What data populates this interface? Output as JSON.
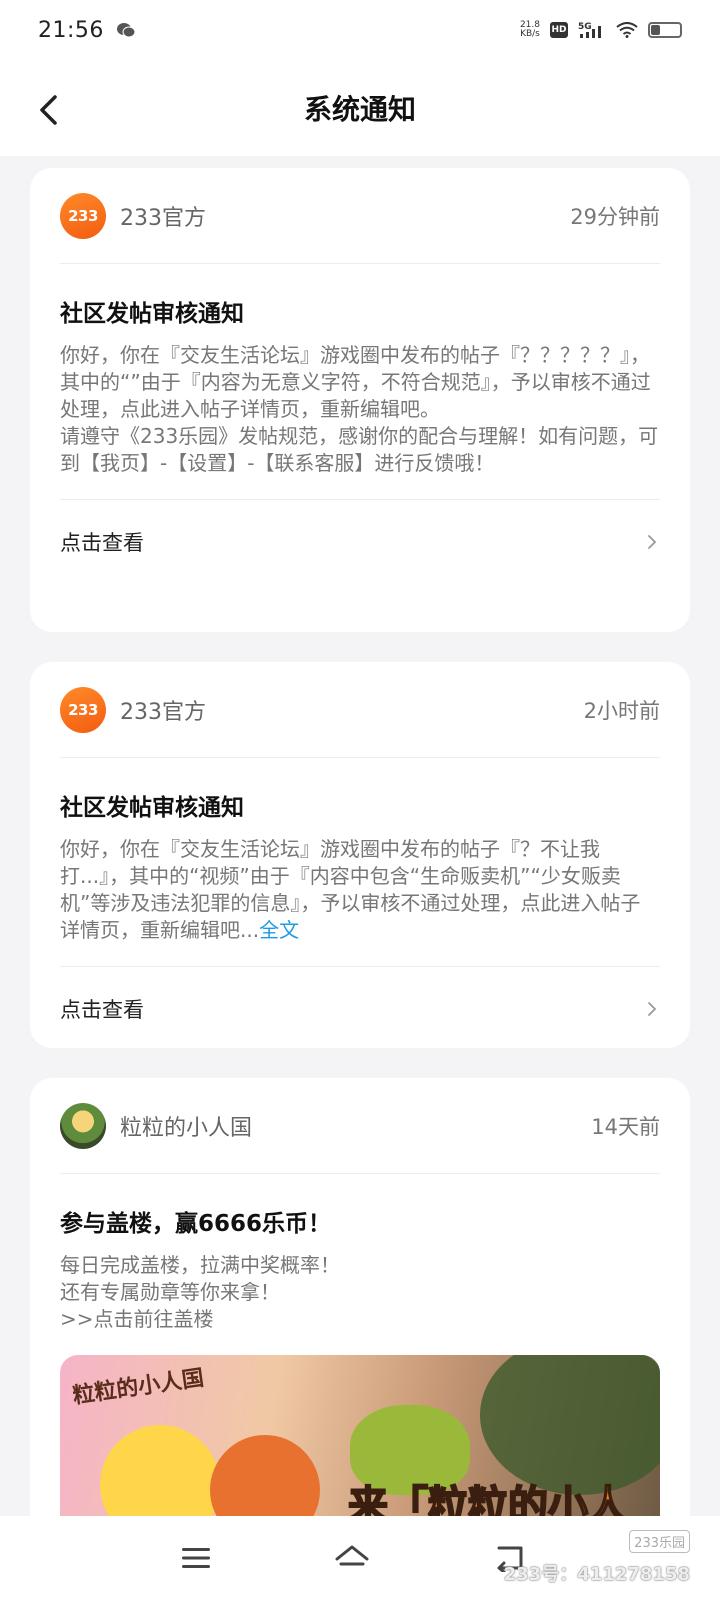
{
  "status_bar": {
    "time": "21:56",
    "net_speed": "21.8",
    "net_unit": "KB/s",
    "hd": "HD",
    "signal": "5G"
  },
  "header": {
    "title": "系统通知"
  },
  "notifications": [
    {
      "sender": "233官方",
      "avatar_text": "233",
      "time": "29分钟前",
      "title": "社区发帖审核通知",
      "body": "你好，你在『交友生活论坛』游戏圈中发布的帖子『？？？？？』，其中的“”由于『内容为无意义字符，不符合规范』，予以审核不通过处理，点此进入帖子详情页，重新编辑吧。\n请遵守《233乐园》发帖规范，感谢你的配合与理解！如有问题，可到【我页】-【设置】-【联系客服】进行反馈哦！",
      "action": "点击查看"
    },
    {
      "sender": "233官方",
      "avatar_text": "233",
      "time": "2小时前",
      "title": "社区发帖审核通知",
      "body": "你好，你在『交友生活论坛』游戏圈中发布的帖子『？不让我打...』，其中的“视频”由于『内容中包含“生命贩卖机”“少女贩卖机”等涉及违法犯罪的信息』，予以审核不通过处理，点此进入帖子详情页，重新编辑吧...",
      "more": "全文",
      "action": "点击查看"
    },
    {
      "sender": "粒粒的小人国",
      "time": "14天前",
      "title": "参与盖楼，赢6666乐币！",
      "body": "每日完成盖楼，拉满中奖概率！\n还有专属勋章等你来拿！\n>>点击前往盖楼",
      "banner_logo": "粒粒的小人国",
      "banner_text": "来「粒粒的小人国」"
    }
  ],
  "watermark": {
    "logo": "233乐园",
    "id": "233号：411278158"
  },
  "icons": {
    "back": "chevron-left-icon",
    "menu": "menu-icon",
    "home": "home-icon",
    "return": "back-icon"
  }
}
